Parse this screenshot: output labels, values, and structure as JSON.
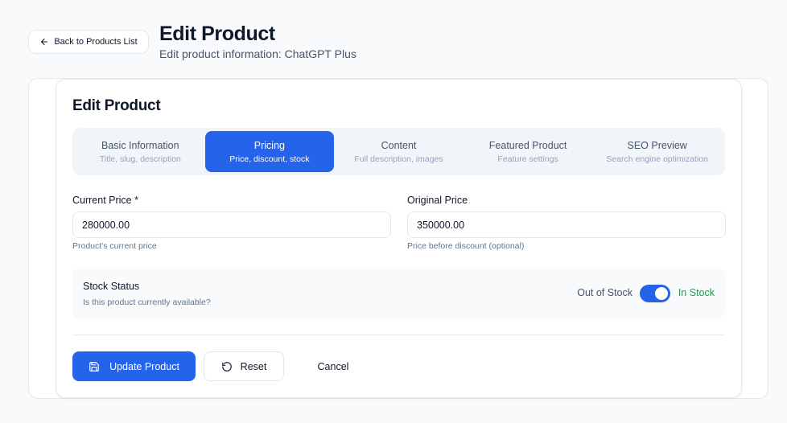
{
  "header": {
    "back_label": "Back to Products List",
    "title": "Edit Product",
    "subtitle": "Edit product information: ChatGPT Plus"
  },
  "card": {
    "title": "Edit Product"
  },
  "tabs": [
    {
      "label": "Basic Information",
      "desc": "Title, slug, description",
      "active": false
    },
    {
      "label": "Pricing",
      "desc": "Price, discount, stock",
      "active": true
    },
    {
      "label": "Content",
      "desc": "Full description, images",
      "active": false
    },
    {
      "label": "Featured Product",
      "desc": "Feature settings",
      "active": false
    },
    {
      "label": "SEO Preview",
      "desc": "Search engine optimization",
      "active": false
    }
  ],
  "pricing": {
    "current_price": {
      "label": "Current Price *",
      "value": "280000.00",
      "help": "Product's current price"
    },
    "original_price": {
      "label": "Original Price",
      "value": "350000.00",
      "help": "Price before discount (optional)"
    }
  },
  "stock": {
    "title": "Stock Status",
    "desc": "Is this product currently available?",
    "off_label": "Out of Stock",
    "on_label": "In Stock",
    "enabled": true
  },
  "actions": {
    "update_label": "Update Product",
    "reset_label": "Reset",
    "cancel_label": "Cancel"
  },
  "colors": {
    "accent": "#2563eb",
    "success": "#16a34a"
  }
}
